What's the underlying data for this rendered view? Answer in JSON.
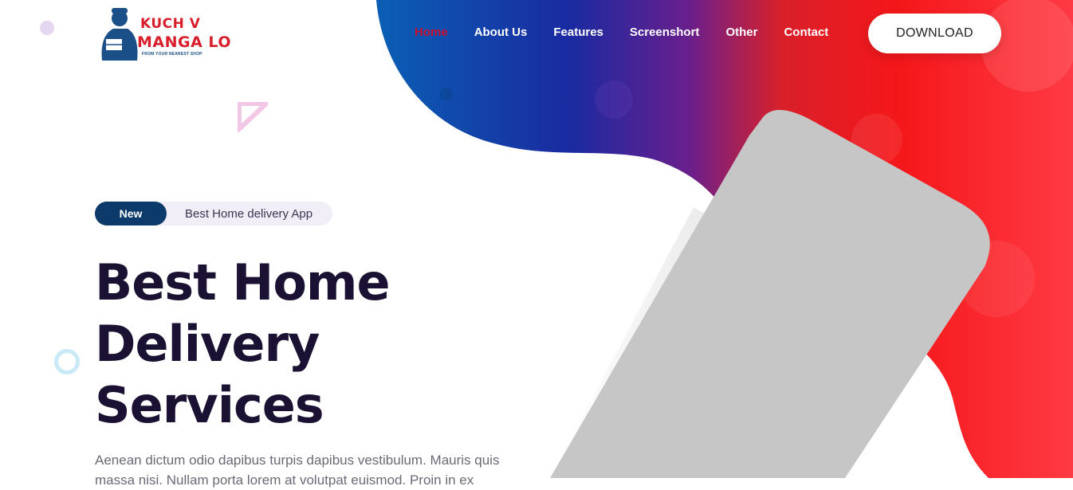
{
  "brand": {
    "line1": "KUCH V",
    "line2": "MANGA LO",
    "tagline": "FROM YOUR NEAREST SHOP"
  },
  "nav": {
    "items": [
      {
        "label": "Home",
        "active": true
      },
      {
        "label": "About Us"
      },
      {
        "label": "Features"
      },
      {
        "label": "Screenshort"
      },
      {
        "label": "Other"
      },
      {
        "label": "Contact"
      }
    ],
    "download_label": "DOWNLOAD"
  },
  "hero": {
    "badge_new": "New",
    "badge_text": "Best Home delivery App",
    "title_lines": [
      "Best Home",
      "Delivery",
      "Services"
    ],
    "description": "Aenean dictum odio dapibus turpis dapibus vestibulum. Mauris quis massa nisi. Nullam porta lorem at volutpat euismod. Proin in ex"
  },
  "colors": {
    "blob_left": "#0c5db0",
    "blob_mid": "#4a1a9c",
    "blob_right": "#f2191e",
    "active_nav": "#c8102e",
    "title": "#1b1233",
    "badge_new_bg": "#0c3a6b",
    "phone": "#c6c6c6"
  },
  "icons": {
    "logo": "delivery-man-icon",
    "deco_dot": "circle-icon",
    "deco_ring": "ring-icon",
    "deco_triangle": "triangle-icon"
  }
}
